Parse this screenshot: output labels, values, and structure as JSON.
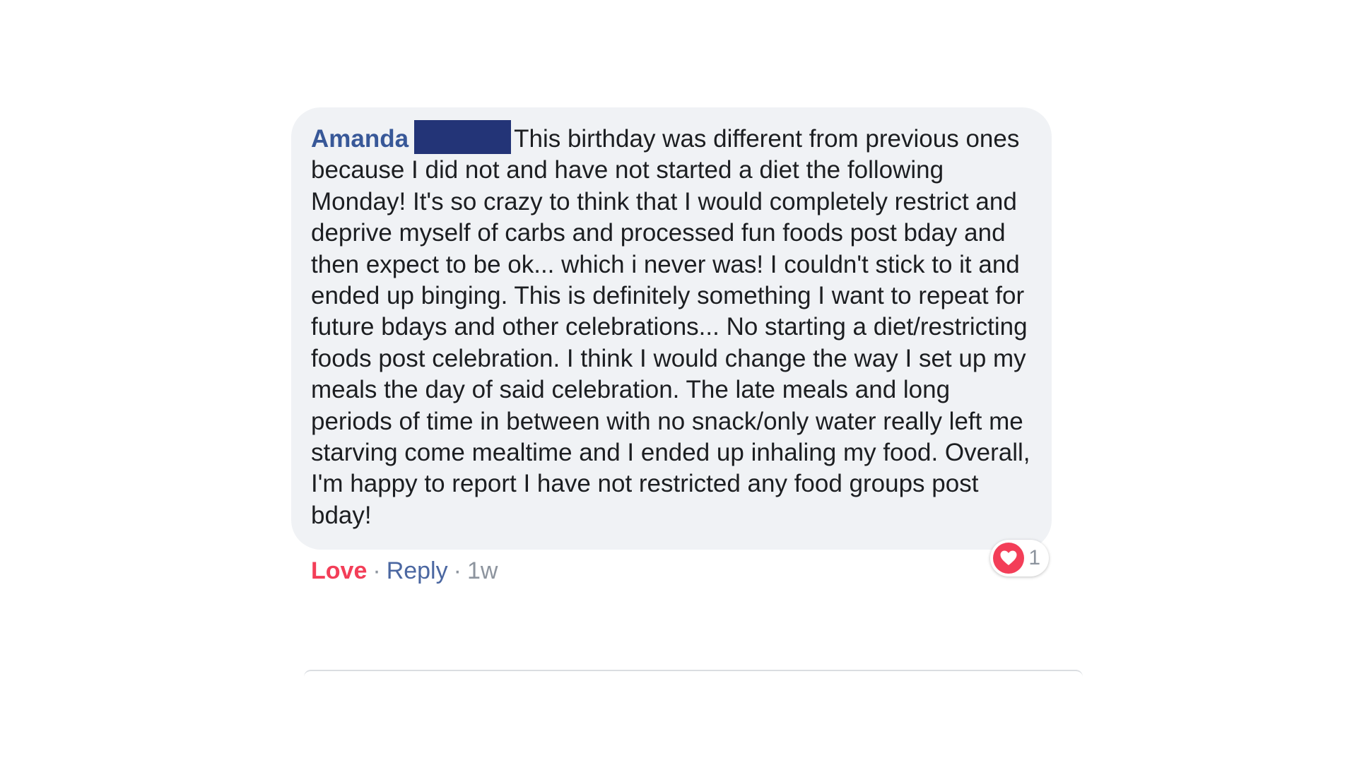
{
  "comment": {
    "author": "Amanda",
    "text": "This birthday was different from previous ones because I did not and have not started a diet the following Monday! It's so crazy to think that I would completely restrict and deprive myself of carbs and processed fun foods post bday and then expect to be ok... which i never was! I couldn't stick to it and ended up binging. This is definitely something I want to repeat for future bdays and other celebrations... No starting a diet/restricting foods post celebration. I think I would change the way I set up my meals the day of said celebration. The late meals and long periods of time in between with no snack/only water really left me starving come mealtime and I ended up inhaling my food. Overall, I'm happy to report I have not restricted any food groups post bday!",
    "reaction": {
      "icon": "heart-icon",
      "count": "1"
    },
    "actions": {
      "love": "Love",
      "separator": "·",
      "reply": "Reply",
      "time": "1w"
    }
  },
  "colors": {
    "bubble_bg": "#f0f2f5",
    "author": "#385898",
    "love": "#f33e58",
    "reply": "#4b67a1",
    "meta": "#8d949e",
    "redaction": "#233477"
  }
}
